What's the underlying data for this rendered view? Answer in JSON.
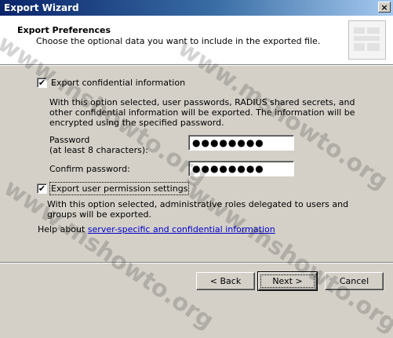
{
  "window": {
    "title": "Export Wizard",
    "close_glyph": "×"
  },
  "header": {
    "title": "Export Preferences",
    "subtitle": "Choose the optional data you want to include in the exported file."
  },
  "confidential": {
    "checked": true,
    "checkmark": "✔",
    "label": "Export confidential information",
    "description": "With this option selected, user passwords, RADIUS shared secrets, and other confidential information will be exported. The information will be encrypted using the specified password."
  },
  "password": {
    "label_line1": "Password",
    "label_line2": "(at least 8 characters):",
    "value": "●●●●●●●●"
  },
  "confirm_password": {
    "label": "Confirm password:",
    "value": "●●●●●●●●"
  },
  "permissions": {
    "checked": true,
    "checkmark": "✔",
    "label": "Export user permission settings",
    "description": "With this option selected, administrative roles delegated to users and groups will be exported."
  },
  "help": {
    "prefix": "Help about",
    "link": "server-specific and confidential information"
  },
  "buttons": {
    "back": "< Back",
    "next": "Next >",
    "cancel": "Cancel"
  },
  "watermark": {
    "text": "www.mshowto.org"
  }
}
